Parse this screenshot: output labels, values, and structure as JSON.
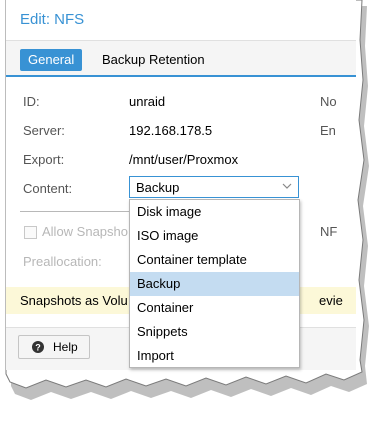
{
  "window": {
    "title": "Edit: NFS"
  },
  "tabs": [
    {
      "label": "General",
      "active": true
    },
    {
      "label": "Backup Retention",
      "active": false
    }
  ],
  "form": {
    "id_label": "ID:",
    "id_value": "unraid",
    "server_label": "Server:",
    "server_value": "192.168.178.5",
    "export_label": "Export:",
    "export_value": "/mnt/user/Proxmox",
    "content_label": "Content:",
    "content_value": "Backup",
    "allow_snapshots_label": "Allow Snapsho",
    "preallocation_label": "Preallocation:",
    "right_col_1": "No",
    "right_col_2": "En",
    "right_col_3": "NF"
  },
  "hint": {
    "text": "Snapshots as Volu",
    "tail": "evie"
  },
  "footer": {
    "help_label": "Help"
  },
  "dropdown": {
    "options": [
      {
        "label": "Disk image",
        "selected": false
      },
      {
        "label": "ISO image",
        "selected": false
      },
      {
        "label": "Container template",
        "selected": false
      },
      {
        "label": "Backup",
        "selected": true
      },
      {
        "label": "Container",
        "selected": false
      },
      {
        "label": "Snippets",
        "selected": false
      },
      {
        "label": "Import",
        "selected": false
      }
    ]
  },
  "colors": {
    "accent": "#3892d4",
    "hint_bg": "#fcf8d8",
    "selected_bg": "#c4dcf1"
  },
  "icons": {
    "dropdown_arrow": "chevron-down-icon",
    "help": "question-circle-icon"
  }
}
